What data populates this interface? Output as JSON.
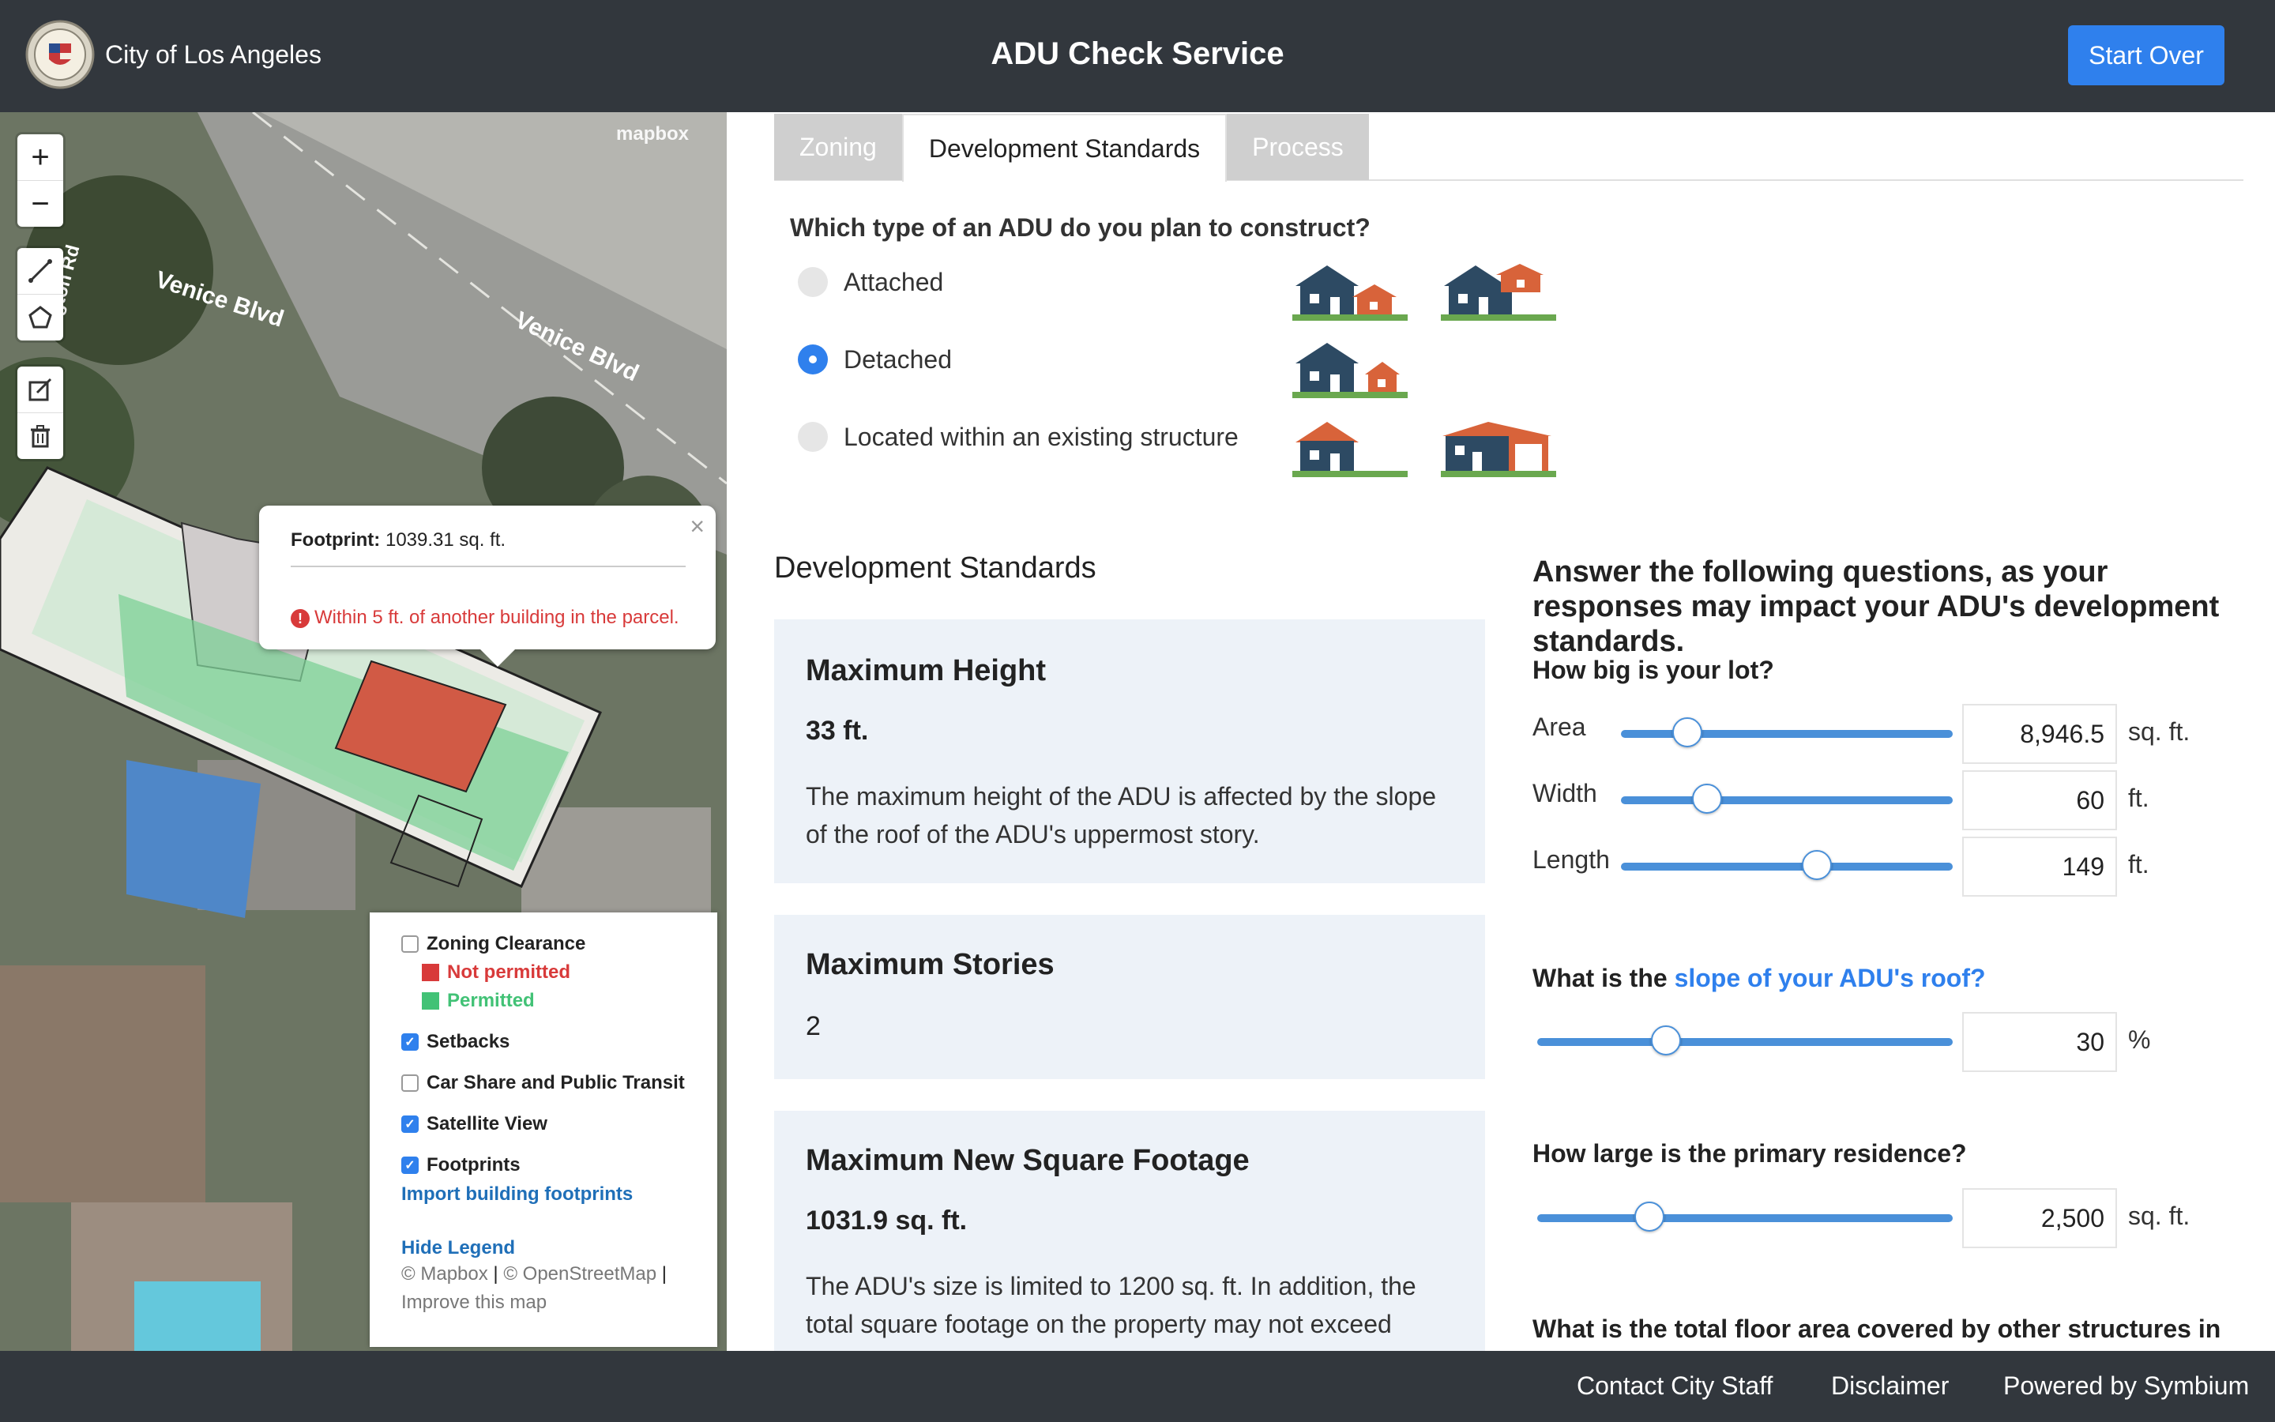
{
  "header": {
    "city_name": "City of Los Angeles",
    "app_title": "ADU Check Service",
    "start_over_label": "Start Over"
  },
  "map": {
    "zoom_in_label": "+",
    "zoom_out_label": "−",
    "attribution_logo": "mapbox",
    "street_labels": [
      "Venice Blvd",
      "Venice Blvd",
      "lington Rd"
    ],
    "popup": {
      "close_label": "×",
      "footprint_label": "Footprint:",
      "footprint_value": "1039.31 sq. ft.",
      "warning": "Within 5 ft. of another building in the parcel."
    },
    "legend": {
      "zoning_clearance": "Zoning Clearance",
      "not_permitted": "Not permitted",
      "permitted": "Permitted",
      "setbacks": "Setbacks",
      "car_share": "Car Share and Public Transit",
      "satellite_view": "Satellite View",
      "footprints": "Footprints",
      "import_link": "Import building footprints",
      "hide_legend": "Hide Legend",
      "attr_mapbox": "© Mapbox",
      "attr_osm": "© OpenStreetMap",
      "attr_improve": "Improve this map",
      "not_permitted_color": "#d83a3a",
      "permitted_color": "#42c276"
    }
  },
  "tabs": [
    {
      "label": "Zoning"
    },
    {
      "label": "Development Standards"
    },
    {
      "label": "Process"
    }
  ],
  "adu_type": {
    "question": "Which type of an ADU do you plan to construct?",
    "options": [
      {
        "label": "Attached",
        "selected": false
      },
      {
        "label": "Detached",
        "selected": true
      },
      {
        "label": "Located within an existing structure",
        "selected": false
      }
    ]
  },
  "standards": {
    "section_title": "Development Standards",
    "cards": [
      {
        "title": "Maximum Height",
        "value": "33 ft.",
        "desc": "The maximum height of the ADU is affected by the slope of the roof of the ADU's uppermost story."
      },
      {
        "title": "Maximum Stories",
        "value": "2"
      },
      {
        "title": "Maximum New Square Footage",
        "value": "1031.9 sq. ft.",
        "desc": "The ADU's size is limited to 1200 sq. ft. In addition, the total square footage on the property may not exceed"
      }
    ]
  },
  "questions": {
    "intro": "Answer the following questions, as your responses may impact your ADU's development standards.",
    "lot_question": "How big is your lot?",
    "area_label": "Area",
    "area_value": "8,946.5",
    "area_unit": "sq. ft.",
    "area_pos": 0.2,
    "width_label": "Width",
    "width_value": "60",
    "width_unit": "ft.",
    "width_pos": 0.26,
    "length_label": "Length",
    "length_value": "149",
    "length_unit": "ft.",
    "length_pos": 0.59,
    "slope_prefix": "What is the ",
    "slope_link": "slope of your ADU's roof?",
    "slope_value": "30",
    "slope_unit": "%",
    "slope_pos": 0.31,
    "primary_question": "How large is the primary residence?",
    "primary_value": "2,500",
    "primary_unit": "sq. ft.",
    "primary_pos": 0.27,
    "other_question": "What is the total floor area covered by other structures in"
  },
  "footer": {
    "contact": "Contact City Staff",
    "disclaimer": "Disclaimer",
    "powered": "Powered by Symbium"
  }
}
